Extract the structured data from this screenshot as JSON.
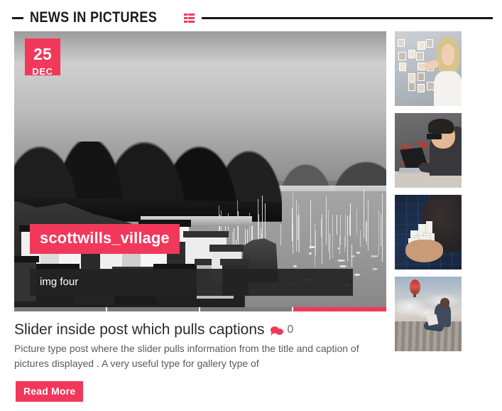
{
  "section": {
    "title": "NEWS IN PICTURES",
    "icon": "grid-list-icon",
    "accent_color": "#f2385a",
    "rule_color": "#161616"
  },
  "slider": {
    "date_badge": {
      "day": "25",
      "month": "DEC"
    },
    "slide_title": "scottwills_village",
    "slide_caption": "img four",
    "image_description": "Black and white photo of a coastal village and harbour with sailboats",
    "pager": {
      "total": 4,
      "active_index": 4,
      "inactive_color": "#7b7b7b",
      "active_color": "#f2385a"
    }
  },
  "post": {
    "title": "Slider inside post which pulls captions",
    "comment_icon": "comment-bubble-icon",
    "comment_count": "0",
    "excerpt": "Picture type post where the slider pulls information from the title and caption of pictures displayed . A very useful type for gallery type of",
    "read_more_label": "Read More"
  },
  "thumbnails": [
    {
      "alt": "Woman touching a wall of profile photographs"
    },
    {
      "alt": "Man with glasses working on a laptop with red particles"
    },
    {
      "alt": "Hand holding a white architectural model on blue technical background"
    },
    {
      "alt": "Person sitting on a wooden dock with a laptop and a hot air balloon in the sky"
    }
  ]
}
